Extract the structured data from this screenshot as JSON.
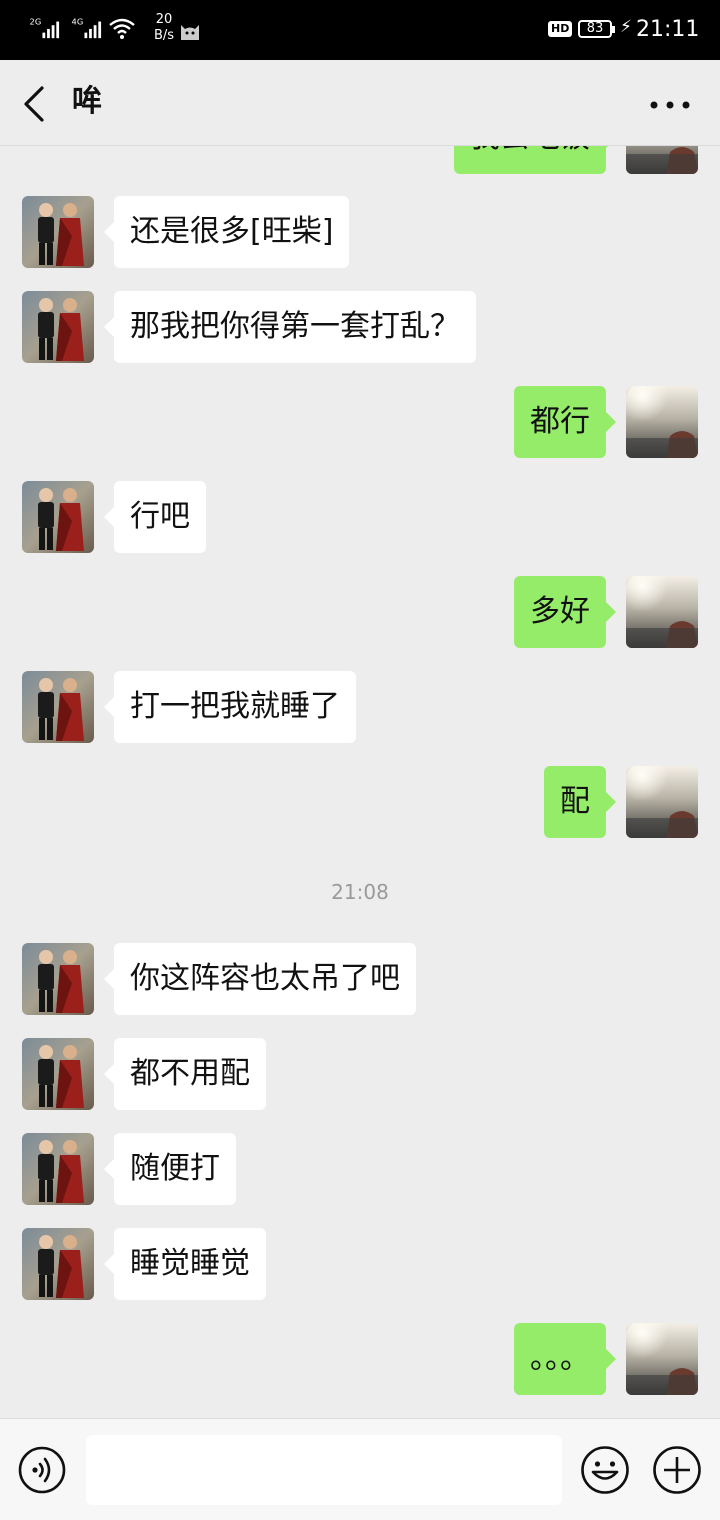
{
  "status_bar": {
    "signal_1": "2G",
    "signal_2": "4G",
    "net_speed_value": "20",
    "net_speed_unit": "B/s",
    "hd_badge": "HD",
    "battery": "83",
    "time": "21:11"
  },
  "header": {
    "title": "哞"
  },
  "messages": [
    {
      "side": "out",
      "text": "我去吃饭",
      "partial": true
    },
    {
      "side": "in",
      "text": "还是很多[旺柴]"
    },
    {
      "side": "in",
      "text": "那我把你得第一套打乱？"
    },
    {
      "side": "out",
      "text": "都行"
    },
    {
      "side": "in",
      "text": "行吧"
    },
    {
      "side": "out",
      "text": "多好"
    },
    {
      "side": "in",
      "text": "打一把我就睡了"
    },
    {
      "side": "out",
      "text": "配"
    },
    {
      "side": "time",
      "text": "21:08"
    },
    {
      "side": "in",
      "text": "你这阵容也太吊了吧"
    },
    {
      "side": "in",
      "text": "都不用配"
    },
    {
      "side": "in",
      "text": "随便打"
    },
    {
      "side": "in",
      "text": "睡觉睡觉"
    },
    {
      "side": "out",
      "text": "。。。"
    }
  ],
  "input": {
    "value": ""
  }
}
